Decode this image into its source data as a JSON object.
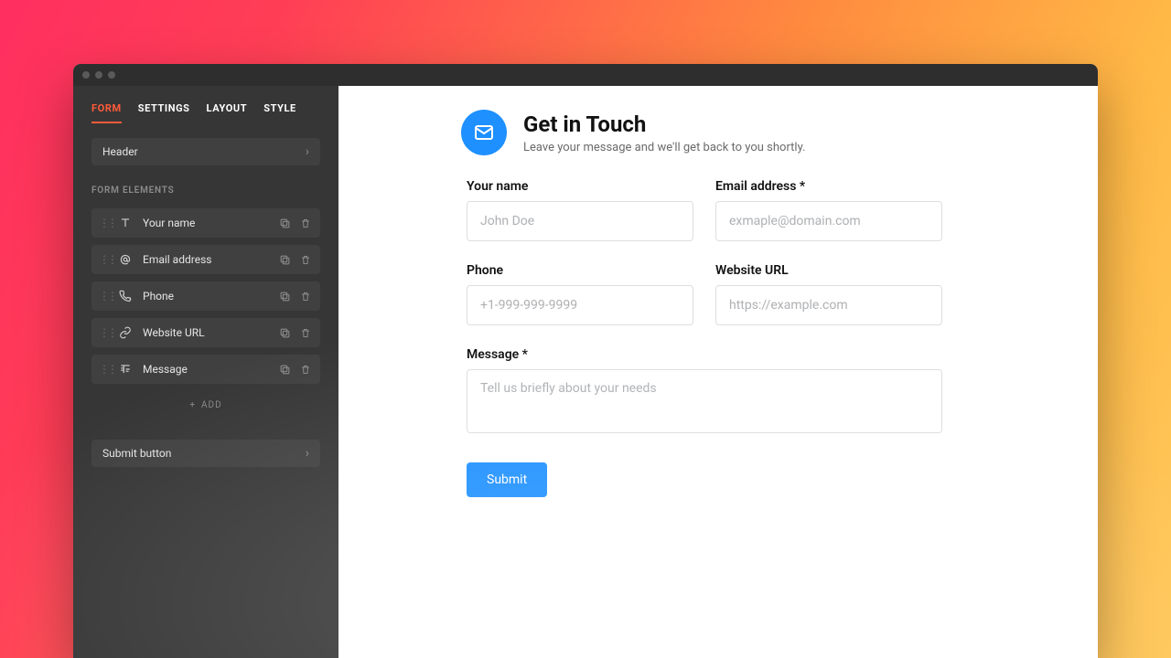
{
  "sidebar": {
    "tabs": [
      "FORM",
      "SETTINGS",
      "LAYOUT",
      "STYLE"
    ],
    "active_tab": 0,
    "header_item": "Header",
    "section_label": "FORM ELEMENTS",
    "elements": [
      {
        "icon": "text",
        "label": "Your name"
      },
      {
        "icon": "at",
        "label": "Email address"
      },
      {
        "icon": "phone",
        "label": "Phone"
      },
      {
        "icon": "link",
        "label": "Website URL"
      },
      {
        "icon": "textarea",
        "label": "Message"
      }
    ],
    "add_label": "ADD",
    "submit_item": "Submit button"
  },
  "form": {
    "title": "Get in Touch",
    "subtitle": "Leave your message and we'll get back to you shortly.",
    "fields": {
      "name": {
        "label": "Your name",
        "placeholder": "John Doe"
      },
      "email": {
        "label": "Email address *",
        "placeholder": "exmaple@domain.com"
      },
      "phone": {
        "label": "Phone",
        "placeholder": "+1-999-999-9999"
      },
      "url": {
        "label": "Website URL",
        "placeholder": "https://example.com"
      },
      "message": {
        "label": "Message *",
        "placeholder": "Tell us briefly about your needs"
      }
    },
    "submit_label": "Submit"
  },
  "colors": {
    "accent": "#1e90ff",
    "tab_active": "#ff5b3a"
  }
}
